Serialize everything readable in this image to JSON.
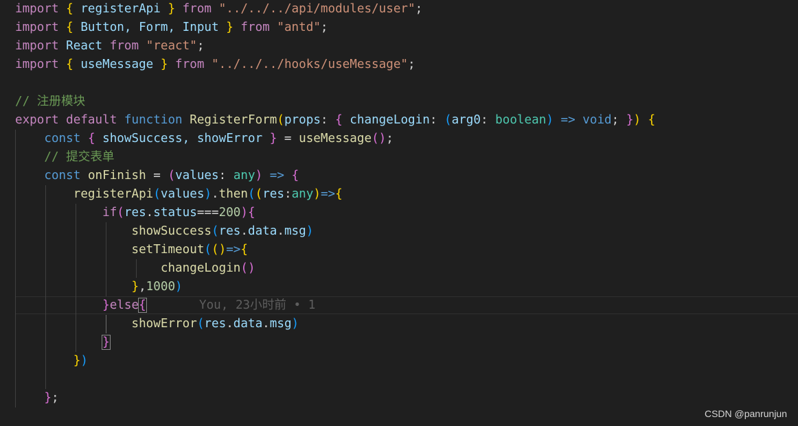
{
  "theme": {
    "keyword": "#c586c0",
    "storage": "#569cd6",
    "function": "#dcdcaa",
    "variable": "#9cdcfe",
    "string": "#ce9178",
    "comment": "#6a9955",
    "number": "#b5cea8",
    "type": "#4ec9b0",
    "plain": "#d4d4d4",
    "bracket1": "#ffd700",
    "bracket2": "#da70d6",
    "bracket3": "#179fff"
  },
  "lines": [
    [
      [
        "import",
        "keyword"
      ],
      [
        " ",
        "plain"
      ],
      [
        "{",
        "bracket1"
      ],
      [
        " registerApi ",
        "variable"
      ],
      [
        "}",
        "bracket1"
      ],
      [
        " from ",
        "keyword"
      ],
      [
        "\"../../../api/modules/user\"",
        "string"
      ],
      [
        ";",
        "plain"
      ]
    ],
    [
      [
        "import",
        "keyword"
      ],
      [
        " ",
        "plain"
      ],
      [
        "{",
        "bracket1"
      ],
      [
        " Button, Form, Input ",
        "variable"
      ],
      [
        "}",
        "bracket1"
      ],
      [
        " from ",
        "keyword"
      ],
      [
        "\"antd\"",
        "string"
      ],
      [
        ";",
        "plain"
      ]
    ],
    [
      [
        "import",
        "keyword"
      ],
      [
        " React ",
        "variable"
      ],
      [
        "from",
        "keyword"
      ],
      [
        " ",
        "plain"
      ],
      [
        "\"react\"",
        "string"
      ],
      [
        ";",
        "plain"
      ]
    ],
    [
      [
        "import",
        "keyword"
      ],
      [
        " ",
        "plain"
      ],
      [
        "{",
        "bracket1"
      ],
      [
        " useMessage ",
        "variable"
      ],
      [
        "}",
        "bracket1"
      ],
      [
        " from ",
        "keyword"
      ],
      [
        "\"../../../hooks/useMessage\"",
        "string"
      ],
      [
        ";",
        "plain"
      ]
    ],
    [],
    [
      [
        "// 注册模块",
        "comment"
      ]
    ],
    [
      [
        "export",
        "keyword"
      ],
      [
        " ",
        "plain"
      ],
      [
        "default",
        "keyword"
      ],
      [
        " ",
        "plain"
      ],
      [
        "function",
        "storage"
      ],
      [
        " ",
        "plain"
      ],
      [
        "RegisterForm",
        "function"
      ],
      [
        "(",
        "bracket1"
      ],
      [
        "props",
        "variable"
      ],
      [
        ": ",
        "plain"
      ],
      [
        "{",
        "bracket2"
      ],
      [
        " changeLogin",
        "variable"
      ],
      [
        ": ",
        "plain"
      ],
      [
        "(",
        "bracket3"
      ],
      [
        "arg0",
        "variable"
      ],
      [
        ": ",
        "plain"
      ],
      [
        "boolean",
        "type"
      ],
      [
        ")",
        "bracket3"
      ],
      [
        " ",
        "plain"
      ],
      [
        "=>",
        "storage"
      ],
      [
        " ",
        "plain"
      ],
      [
        "void",
        "storage"
      ],
      [
        "; ",
        "plain"
      ],
      [
        "}",
        "bracket2"
      ],
      [
        ")",
        "bracket1"
      ],
      [
        " ",
        "plain"
      ],
      [
        "{",
        "bracket1"
      ]
    ],
    [
      [
        "    ",
        "plain"
      ],
      [
        "const",
        "storage"
      ],
      [
        " ",
        "plain"
      ],
      [
        "{",
        "bracket2"
      ],
      [
        " showSuccess, showError ",
        "variable"
      ],
      [
        "}",
        "bracket2"
      ],
      [
        " = ",
        "plain"
      ],
      [
        "useMessage",
        "function"
      ],
      [
        "(",
        "bracket2"
      ],
      [
        ")",
        "bracket2"
      ],
      [
        ";",
        "plain"
      ]
    ],
    [
      [
        "    ",
        "plain"
      ],
      [
        "// 提交表单",
        "comment"
      ]
    ],
    [
      [
        "    ",
        "plain"
      ],
      [
        "const",
        "storage"
      ],
      [
        " ",
        "plain"
      ],
      [
        "onFinish",
        "function"
      ],
      [
        " = ",
        "plain"
      ],
      [
        "(",
        "bracket2"
      ],
      [
        "values",
        "variable"
      ],
      [
        ": ",
        "plain"
      ],
      [
        "any",
        "type"
      ],
      [
        ")",
        "bracket2"
      ],
      [
        " ",
        "plain"
      ],
      [
        "=>",
        "storage"
      ],
      [
        " ",
        "plain"
      ],
      [
        "{",
        "bracket2"
      ]
    ],
    [
      [
        "        ",
        "plain"
      ],
      [
        "registerApi",
        "function"
      ],
      [
        "(",
        "bracket3"
      ],
      [
        "values",
        "variable"
      ],
      [
        ")",
        "bracket3"
      ],
      [
        ".",
        "plain"
      ],
      [
        "then",
        "function"
      ],
      [
        "(",
        "bracket3"
      ],
      [
        "(",
        "bracket1"
      ],
      [
        "res",
        "variable"
      ],
      [
        ":",
        "plain"
      ],
      [
        "any",
        "type"
      ],
      [
        ")",
        "bracket1"
      ],
      [
        "=>",
        "storage"
      ],
      [
        "{",
        "bracket1"
      ]
    ],
    [
      [
        "            ",
        "plain"
      ],
      [
        "if",
        "keyword"
      ],
      [
        "(",
        "bracket2"
      ],
      [
        "res",
        "variable"
      ],
      [
        ".",
        "plain"
      ],
      [
        "status",
        "variable"
      ],
      [
        "===",
        "plain"
      ],
      [
        "200",
        "number"
      ],
      [
        ")",
        "bracket2"
      ],
      [
        "{",
        "bracket2"
      ]
    ],
    [
      [
        "                ",
        "plain"
      ],
      [
        "showSuccess",
        "function"
      ],
      [
        "(",
        "bracket3"
      ],
      [
        "res",
        "variable"
      ],
      [
        ".",
        "plain"
      ],
      [
        "data",
        "variable"
      ],
      [
        ".",
        "plain"
      ],
      [
        "msg",
        "variable"
      ],
      [
        ")",
        "bracket3"
      ]
    ],
    [
      [
        "                ",
        "plain"
      ],
      [
        "setTimeout",
        "function"
      ],
      [
        "(",
        "bracket3"
      ],
      [
        "(",
        "bracket1"
      ],
      [
        ")",
        "bracket1"
      ],
      [
        "=>",
        "storage"
      ],
      [
        "{",
        "bracket1"
      ]
    ],
    [
      [
        "                    ",
        "plain"
      ],
      [
        "changeLogin",
        "function"
      ],
      [
        "(",
        "bracket2"
      ],
      [
        ")",
        "bracket2"
      ]
    ],
    [
      [
        "                ",
        "plain"
      ],
      [
        "}",
        "bracket1"
      ],
      [
        ",",
        "plain"
      ],
      [
        "1000",
        "number"
      ],
      [
        ")",
        "bracket3"
      ]
    ],
    [
      [
        "            ",
        "plain"
      ],
      [
        "}",
        "bracket2"
      ],
      [
        "else",
        "keyword"
      ],
      [
        "{",
        "bracket2"
      ]
    ],
    [
      [
        "                ",
        "plain"
      ],
      [
        "showError",
        "function"
      ],
      [
        "(",
        "bracket3"
      ],
      [
        "res",
        "variable"
      ],
      [
        ".",
        "plain"
      ],
      [
        "data",
        "variable"
      ],
      [
        ".",
        "plain"
      ],
      [
        "msg",
        "variable"
      ],
      [
        ")",
        "bracket3"
      ]
    ],
    [
      [
        "            ",
        "plain"
      ],
      [
        "}",
        "bracket2"
      ]
    ],
    [
      [
        "        ",
        "plain"
      ],
      [
        "}",
        "bracket1"
      ],
      [
        ")",
        "bracket3"
      ]
    ],
    [],
    [
      [
        "    ",
        "plain"
      ],
      [
        "}",
        "bracket2"
      ],
      [
        ";",
        "plain"
      ]
    ]
  ],
  "blame": "You, 23小时前 • 1",
  "watermark": "CSDN @panrunjun"
}
